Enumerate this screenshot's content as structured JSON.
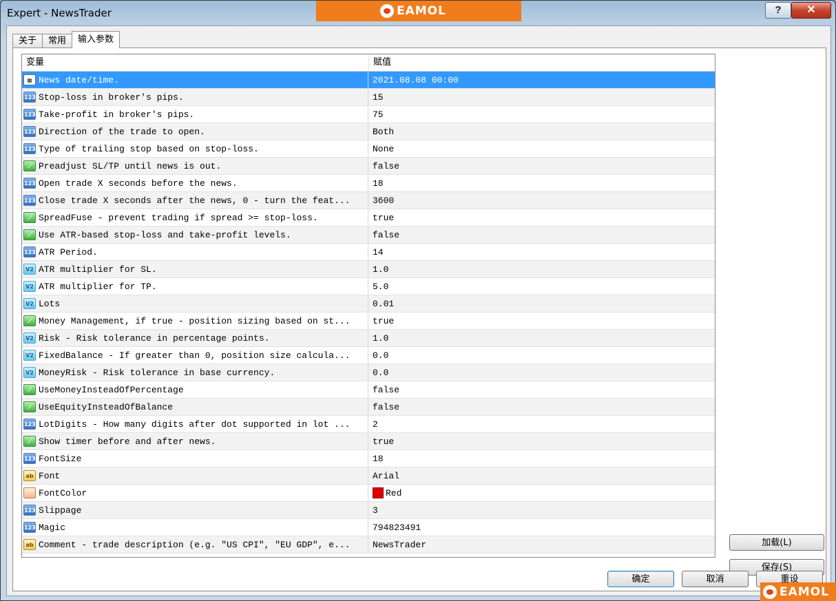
{
  "window": {
    "title": "Expert - NewsTrader",
    "brand": "EAMOL",
    "help_label": "?",
    "close_label": "✕"
  },
  "tabs": [
    {
      "label": "关于",
      "active": false
    },
    {
      "label": "常用",
      "active": false
    },
    {
      "label": "输入参数",
      "active": true
    }
  ],
  "grid": {
    "col_variable": "变量",
    "col_value": "赋值",
    "rows": [
      {
        "icon": "datetime-icon",
        "name": "News date/time.",
        "value": "2021.08.08 00:00",
        "selected": true
      },
      {
        "icon": "int-icon",
        "name": "Stop-loss in broker's pips.",
        "value": "15"
      },
      {
        "icon": "int-icon",
        "name": "Take-profit in broker's pips.",
        "value": "75"
      },
      {
        "icon": "int-icon",
        "name": "Direction of the trade to open.",
        "value": "Both"
      },
      {
        "icon": "int-icon",
        "name": "Type of trailing stop based on stop-loss.",
        "value": "None"
      },
      {
        "icon": "bool-icon",
        "name": "Preadjust SL/TP until news is out.",
        "value": "false"
      },
      {
        "icon": "int-icon",
        "name": "Open trade X seconds before the news.",
        "value": "18"
      },
      {
        "icon": "int-icon",
        "name": "Close trade X seconds after the news, 0 - turn the feat...",
        "value": "3600"
      },
      {
        "icon": "bool-icon",
        "name": "SpreadFuse - prevent trading if spread >= stop-loss.",
        "value": "true"
      },
      {
        "icon": "bool-icon",
        "name": "Use ATR-based stop-loss and take-profit levels.",
        "value": "false"
      },
      {
        "icon": "int-icon",
        "name": "ATR Period.",
        "value": "14"
      },
      {
        "icon": "double-icon",
        "name": "ATR multiplier for SL.",
        "value": "1.0"
      },
      {
        "icon": "double-icon",
        "name": "ATR multiplier for TP.",
        "value": "5.0"
      },
      {
        "icon": "double-icon",
        "name": "Lots",
        "value": "0.01"
      },
      {
        "icon": "bool-icon",
        "name": "Money Management, if true - position sizing based on st...",
        "value": "true"
      },
      {
        "icon": "double-icon",
        "name": "Risk - Risk tolerance in percentage points.",
        "value": "1.0"
      },
      {
        "icon": "double-icon",
        "name": "FixedBalance - If greater than 0, position size calcula...",
        "value": "0.0"
      },
      {
        "icon": "double-icon",
        "name": "MoneyRisk - Risk tolerance in base currency.",
        "value": "0.0"
      },
      {
        "icon": "bool-icon",
        "name": "UseMoneyInsteadOfPercentage",
        "value": "false"
      },
      {
        "icon": "bool-icon",
        "name": "UseEquityInsteadOfBalance",
        "value": "false"
      },
      {
        "icon": "int-icon",
        "name": "LotDigits - How many digits after dot supported in lot ...",
        "value": "2"
      },
      {
        "icon": "bool-icon",
        "name": "Show timer before and after news.",
        "value": "true"
      },
      {
        "icon": "int-icon",
        "name": "FontSize",
        "value": "18"
      },
      {
        "icon": "string-icon",
        "name": "Font",
        "value": "Arial"
      },
      {
        "icon": "color-icon",
        "name": "FontColor",
        "value": "Red",
        "swatch": "#e00000"
      },
      {
        "icon": "int-icon",
        "name": "Slippage",
        "value": "3"
      },
      {
        "icon": "int-icon",
        "name": "Magic",
        "value": "794823491"
      },
      {
        "icon": "string-icon",
        "name": "Comment - trade description (e.g. \"US CPI\", \"EU GDP\", e...",
        "value": "NewsTrader"
      }
    ]
  },
  "buttons": {
    "load": "加载(L)",
    "save": "保存(S)",
    "ok": "确定",
    "cancel": "取消",
    "reset": "重设"
  },
  "colors": {
    "selection": "#3399ff",
    "brand": "#f07c1c"
  }
}
